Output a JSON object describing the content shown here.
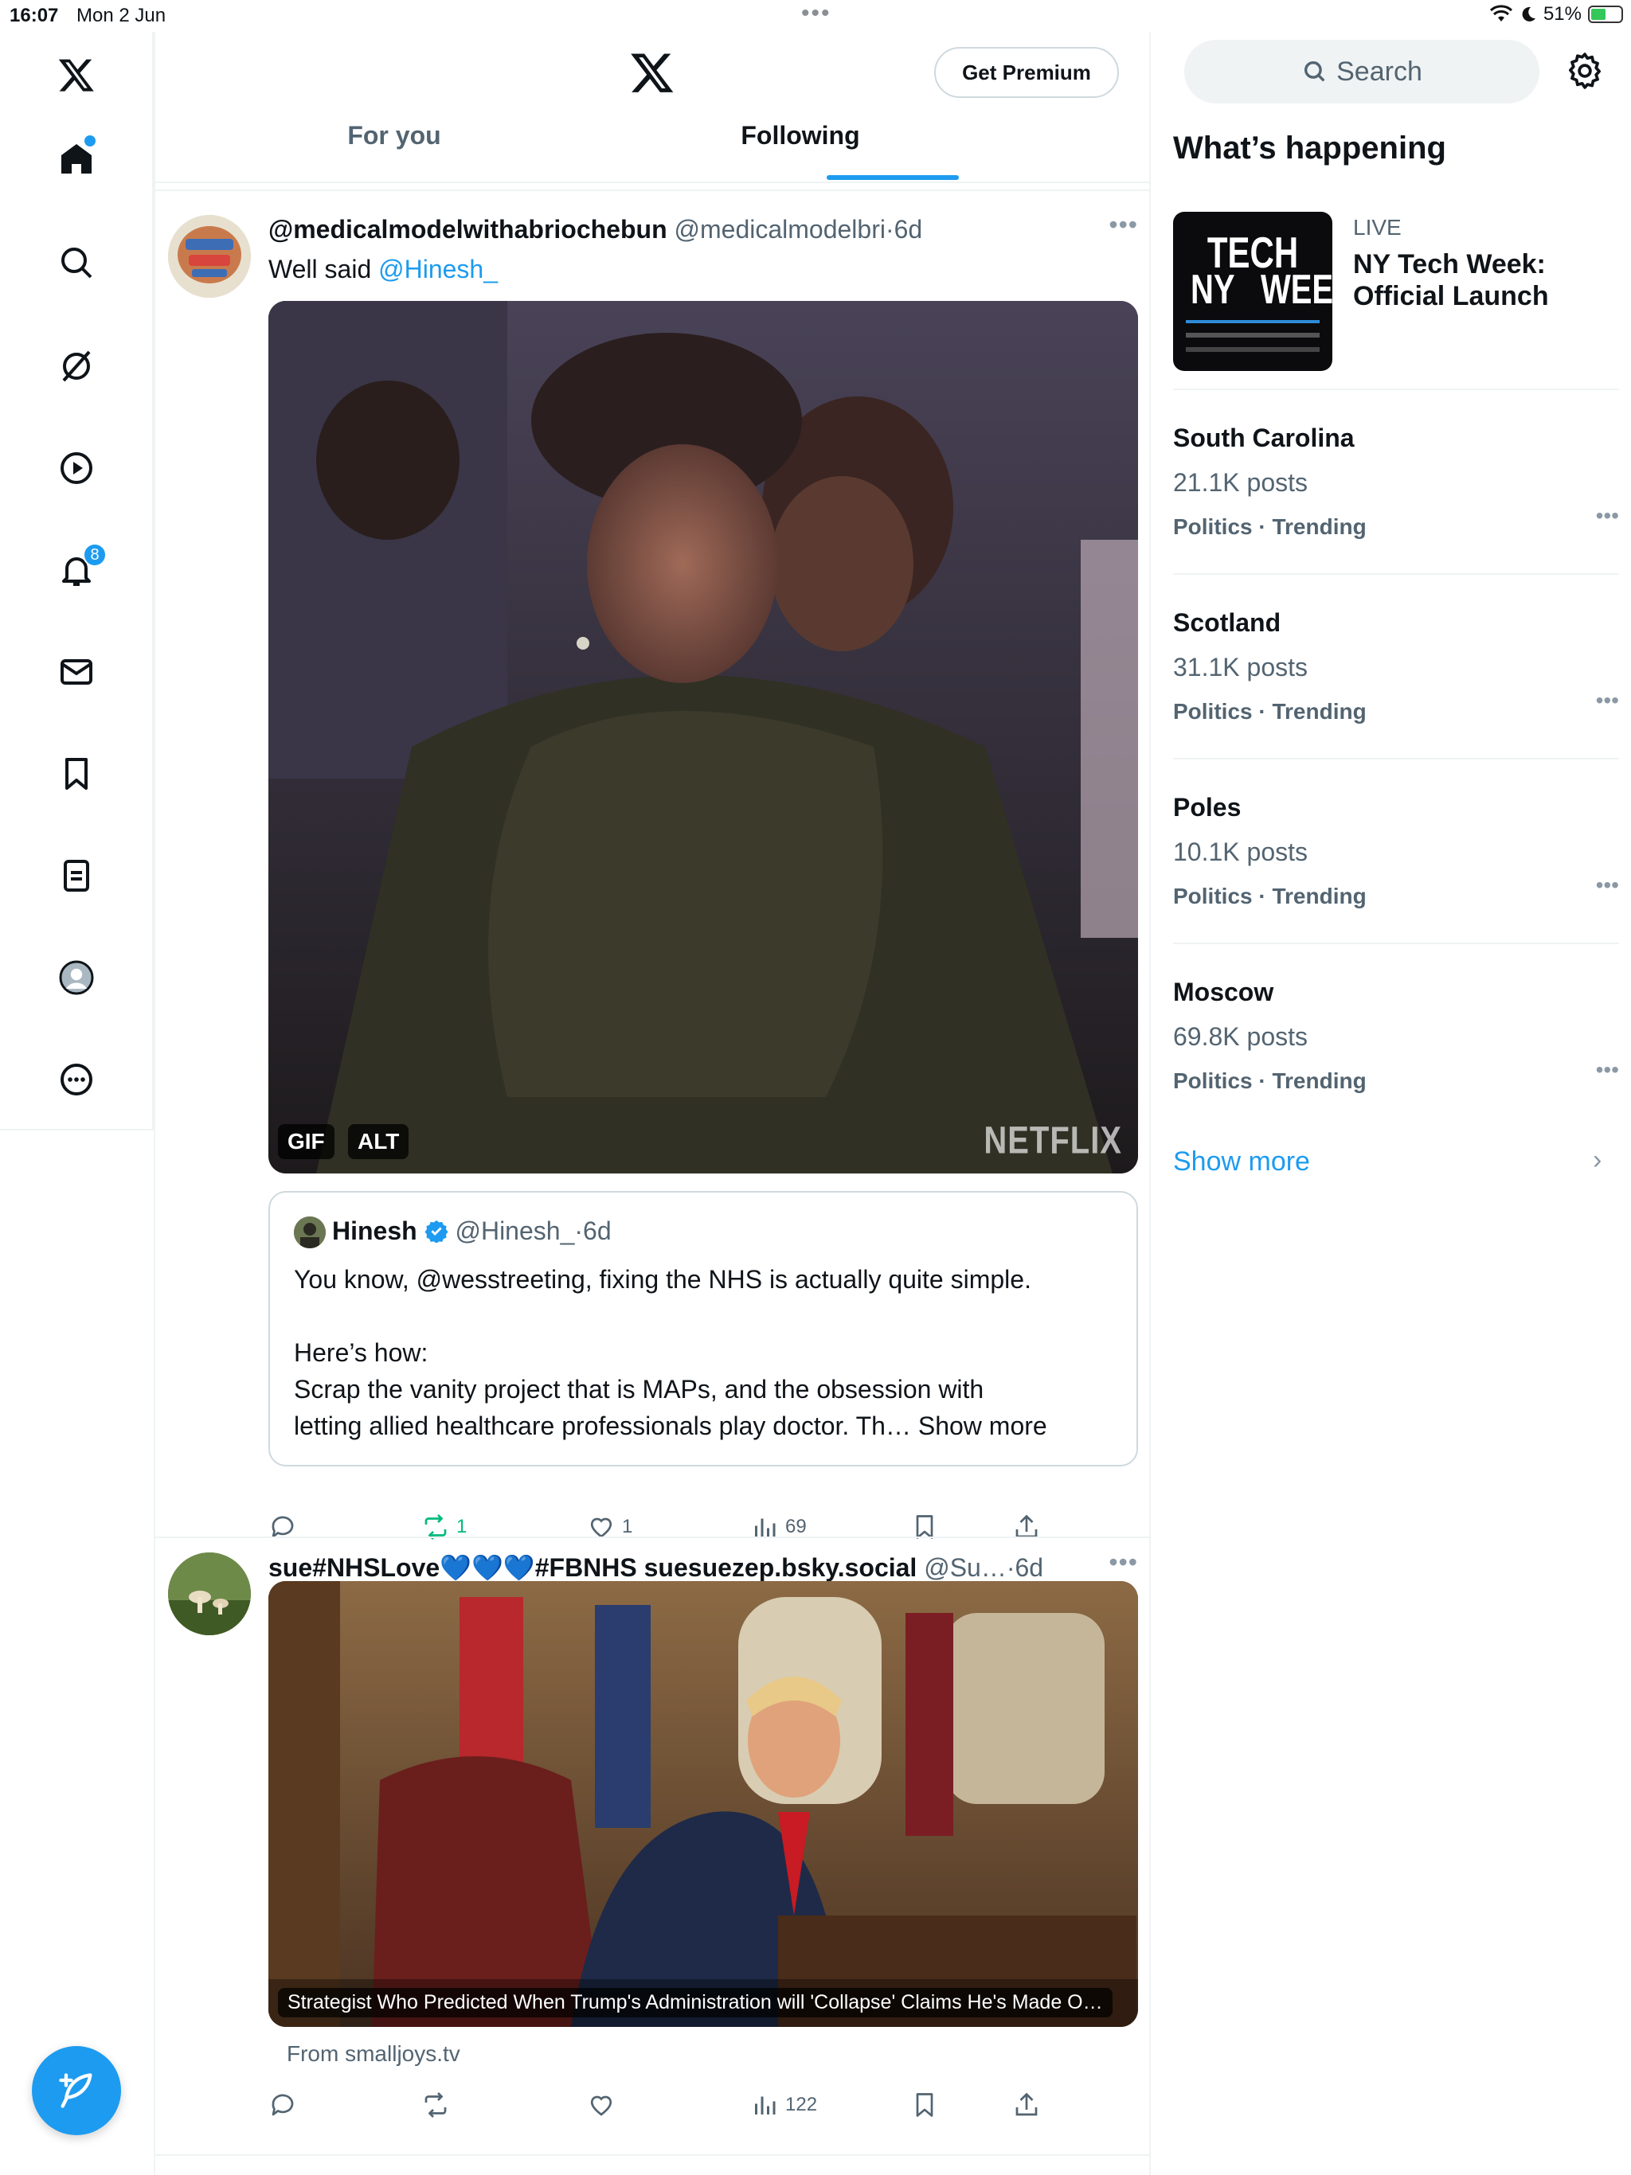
{
  "status_bar": {
    "time": "16:07",
    "date": "Mon 2 Jun",
    "battery": "51%",
    "battery_level": 0.51
  },
  "nav": {
    "notification_count": "8",
    "items": [
      "x-logo",
      "home",
      "search",
      "grok",
      "videos",
      "notifications",
      "messages",
      "bookmarks",
      "lists",
      "profile",
      "more"
    ]
  },
  "header": {
    "premium_label": "Get Premium",
    "tabs": [
      {
        "label": "For you",
        "active": false
      },
      {
        "label": "Following",
        "active": true
      }
    ]
  },
  "tweets": [
    {
      "name": "@medicalmodelwithabriochebun",
      "handle": "@medicalmodelbri",
      "sep": "·",
      "time": "6d",
      "text_prefix": "Well said ",
      "text_mention": "@Hinesh_",
      "media_tags": [
        "GIF",
        "ALT"
      ],
      "media_watermark": "NETFLIX",
      "quote": {
        "name": "Hinesh",
        "handle": "@Hinesh_",
        "sep": "·",
        "time": "6d",
        "line1": "You know, @wesstreeting, fixing the NHS is actually quite simple.",
        "line2": "Here’s how:",
        "line3": "Scrap the vanity project that is MAPs, and the obsession with",
        "line4": "letting allied healthcare professionals play doctor. Th…",
        "show_more": "Show more"
      },
      "stats": {
        "replies": "",
        "reposts": "1",
        "likes": "1",
        "views": "69"
      }
    },
    {
      "name": "sue#NHSLove💙💙💙#FBNHS suesuezep.bsky.social",
      "handle": "@Su…",
      "sep": "·",
      "time": "6d",
      "card_title": "Strategist Who Predicted When Trump's Administration will 'Collapse' Claims He's Made O…",
      "card_source": "From smalljoys.tv",
      "stats": {
        "replies": "",
        "reposts": "",
        "likes": "",
        "views": "122"
      }
    }
  ],
  "sidebar": {
    "search_placeholder": "Search",
    "section_title": "What’s happening",
    "live": {
      "label": "LIVE",
      "title": "NY Tech Week: Official Launch",
      "image_text": {
        "line1": "TECH",
        "ny": "NY",
        "week": "WEEK"
      }
    },
    "trends": [
      {
        "name": "South Carolina",
        "posts": "21.1K posts",
        "category": "Politics · Trending"
      },
      {
        "name": "Scotland",
        "posts": "31.1K posts",
        "category": "Politics · Trending"
      },
      {
        "name": "Poles",
        "posts": "10.1K posts",
        "category": "Politics · Trending"
      },
      {
        "name": "Moscow",
        "posts": "69.8K posts",
        "category": "Politics · Trending"
      }
    ],
    "show_more": "Show more"
  },
  "colors": {
    "accent": "#1d9bf0",
    "repost_active": "#00ba7c",
    "text_secondary": "#536471",
    "border": "#eff3f4"
  }
}
